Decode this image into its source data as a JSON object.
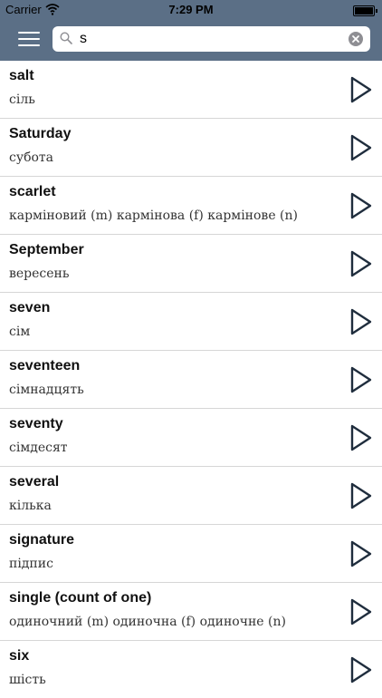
{
  "status": {
    "carrier": "Carrier",
    "time": "7:29 PM"
  },
  "search": {
    "value": "s"
  },
  "entries": [
    {
      "word": "salt",
      "translation": "сіль"
    },
    {
      "word": "Saturday",
      "translation": "субота"
    },
    {
      "word": "scarlet",
      "translation": "карміновий (m)  кармінова (f)  кармінове (n)"
    },
    {
      "word": "September",
      "translation": "вересень"
    },
    {
      "word": "seven",
      "translation": "сім"
    },
    {
      "word": "seventeen",
      "translation": "сімнадцять"
    },
    {
      "word": "seventy",
      "translation": "сімдесят"
    },
    {
      "word": "several",
      "translation": "кілька"
    },
    {
      "word": "signature",
      "translation": "підпис"
    },
    {
      "word": "single (count of one)",
      "translation": "одиночний (m)  одиночна (f)  одиночне (n)"
    },
    {
      "word": "six",
      "translation": "шість"
    }
  ],
  "colors": {
    "header": "#5b6f86",
    "accent": "#5b6f86"
  },
  "icons": {
    "menu": "hamburger-icon",
    "search": "magnifier-icon",
    "clear": "clear-x-icon",
    "play": "play-triangle-icon"
  }
}
